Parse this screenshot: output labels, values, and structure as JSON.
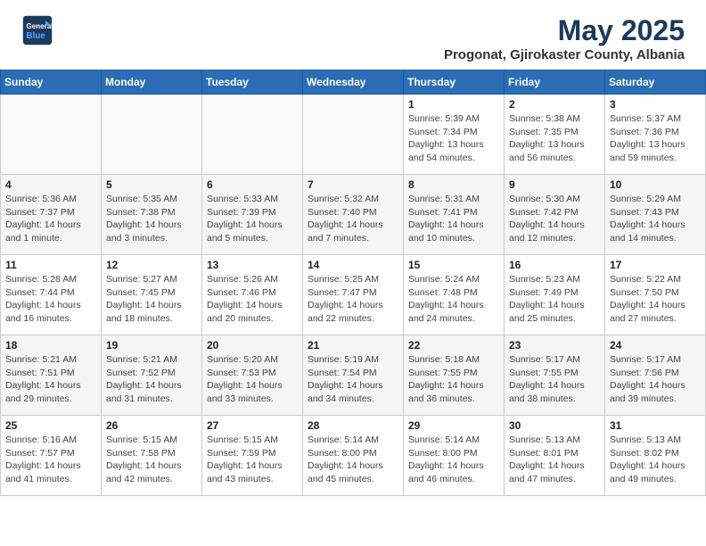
{
  "header": {
    "logo_line1": "General",
    "logo_line2": "Blue",
    "month": "May 2025",
    "location": "Progonat, Gjirokaster County, Albania"
  },
  "weekdays": [
    "Sunday",
    "Monday",
    "Tuesday",
    "Wednesday",
    "Thursday",
    "Friday",
    "Saturday"
  ],
  "weeks": [
    [
      {
        "day": "",
        "info": ""
      },
      {
        "day": "",
        "info": ""
      },
      {
        "day": "",
        "info": ""
      },
      {
        "day": "",
        "info": ""
      },
      {
        "day": "1",
        "info": "Sunrise: 5:39 AM\nSunset: 7:34 PM\nDaylight: 13 hours\nand 54 minutes."
      },
      {
        "day": "2",
        "info": "Sunrise: 5:38 AM\nSunset: 7:35 PM\nDaylight: 13 hours\nand 56 minutes."
      },
      {
        "day": "3",
        "info": "Sunrise: 5:37 AM\nSunset: 7:36 PM\nDaylight: 13 hours\nand 59 minutes."
      }
    ],
    [
      {
        "day": "4",
        "info": "Sunrise: 5:36 AM\nSunset: 7:37 PM\nDaylight: 14 hours\nand 1 minute."
      },
      {
        "day": "5",
        "info": "Sunrise: 5:35 AM\nSunset: 7:38 PM\nDaylight: 14 hours\nand 3 minutes."
      },
      {
        "day": "6",
        "info": "Sunrise: 5:33 AM\nSunset: 7:39 PM\nDaylight: 14 hours\nand 5 minutes."
      },
      {
        "day": "7",
        "info": "Sunrise: 5:32 AM\nSunset: 7:40 PM\nDaylight: 14 hours\nand 7 minutes."
      },
      {
        "day": "8",
        "info": "Sunrise: 5:31 AM\nSunset: 7:41 PM\nDaylight: 14 hours\nand 10 minutes."
      },
      {
        "day": "9",
        "info": "Sunrise: 5:30 AM\nSunset: 7:42 PM\nDaylight: 14 hours\nand 12 minutes."
      },
      {
        "day": "10",
        "info": "Sunrise: 5:29 AM\nSunset: 7:43 PM\nDaylight: 14 hours\nand 14 minutes."
      }
    ],
    [
      {
        "day": "11",
        "info": "Sunrise: 5:28 AM\nSunset: 7:44 PM\nDaylight: 14 hours\nand 16 minutes."
      },
      {
        "day": "12",
        "info": "Sunrise: 5:27 AM\nSunset: 7:45 PM\nDaylight: 14 hours\nand 18 minutes."
      },
      {
        "day": "13",
        "info": "Sunrise: 5:26 AM\nSunset: 7:46 PM\nDaylight: 14 hours\nand 20 minutes."
      },
      {
        "day": "14",
        "info": "Sunrise: 5:25 AM\nSunset: 7:47 PM\nDaylight: 14 hours\nand 22 minutes."
      },
      {
        "day": "15",
        "info": "Sunrise: 5:24 AM\nSunset: 7:48 PM\nDaylight: 14 hours\nand 24 minutes."
      },
      {
        "day": "16",
        "info": "Sunrise: 5:23 AM\nSunset: 7:49 PM\nDaylight: 14 hours\nand 25 minutes."
      },
      {
        "day": "17",
        "info": "Sunrise: 5:22 AM\nSunset: 7:50 PM\nDaylight: 14 hours\nand 27 minutes."
      }
    ],
    [
      {
        "day": "18",
        "info": "Sunrise: 5:21 AM\nSunset: 7:51 PM\nDaylight: 14 hours\nand 29 minutes."
      },
      {
        "day": "19",
        "info": "Sunrise: 5:21 AM\nSunset: 7:52 PM\nDaylight: 14 hours\nand 31 minutes."
      },
      {
        "day": "20",
        "info": "Sunrise: 5:20 AM\nSunset: 7:53 PM\nDaylight: 14 hours\nand 33 minutes."
      },
      {
        "day": "21",
        "info": "Sunrise: 5:19 AM\nSunset: 7:54 PM\nDaylight: 14 hours\nand 34 minutes."
      },
      {
        "day": "22",
        "info": "Sunrise: 5:18 AM\nSunset: 7:55 PM\nDaylight: 14 hours\nand 36 minutes."
      },
      {
        "day": "23",
        "info": "Sunrise: 5:17 AM\nSunset: 7:55 PM\nDaylight: 14 hours\nand 38 minutes."
      },
      {
        "day": "24",
        "info": "Sunrise: 5:17 AM\nSunset: 7:56 PM\nDaylight: 14 hours\nand 39 minutes."
      }
    ],
    [
      {
        "day": "25",
        "info": "Sunrise: 5:16 AM\nSunset: 7:57 PM\nDaylight: 14 hours\nand 41 minutes."
      },
      {
        "day": "26",
        "info": "Sunrise: 5:15 AM\nSunset: 7:58 PM\nDaylight: 14 hours\nand 42 minutes."
      },
      {
        "day": "27",
        "info": "Sunrise: 5:15 AM\nSunset: 7:59 PM\nDaylight: 14 hours\nand 43 minutes."
      },
      {
        "day": "28",
        "info": "Sunrise: 5:14 AM\nSunset: 8:00 PM\nDaylight: 14 hours\nand 45 minutes."
      },
      {
        "day": "29",
        "info": "Sunrise: 5:14 AM\nSunset: 8:00 PM\nDaylight: 14 hours\nand 46 minutes."
      },
      {
        "day": "30",
        "info": "Sunrise: 5:13 AM\nSunset: 8:01 PM\nDaylight: 14 hours\nand 47 minutes."
      },
      {
        "day": "31",
        "info": "Sunrise: 5:13 AM\nSunset: 8:02 PM\nDaylight: 14 hours\nand 49 minutes."
      }
    ]
  ]
}
